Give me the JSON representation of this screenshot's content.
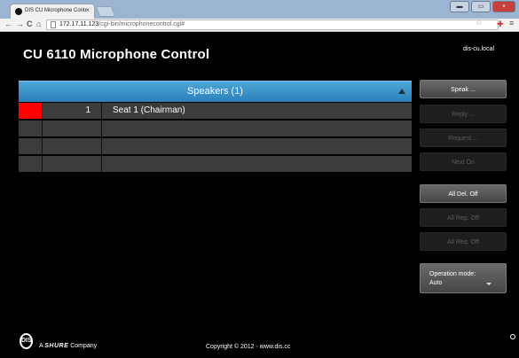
{
  "browser": {
    "tab_title": "DIS CU Microphone Contr",
    "tab_close": "×",
    "url_host": "172.17.11.123",
    "url_path": "/cgi-bin/microphonecontrol.cgi#",
    "back": "←",
    "forward": "→",
    "reload": "C",
    "home": "⌂",
    "star": "☆",
    "menu": "≡",
    "window_buttons": [
      "▬",
      "▭",
      "×"
    ]
  },
  "app": {
    "title": "CU 6110 Microphone Control",
    "hostname": "dis-cu.local"
  },
  "speakers": {
    "header": "Speakers (1)",
    "rows": [
      {
        "active": true,
        "number": "1",
        "name": "Seat 1 (Chairman)"
      },
      {
        "active": false,
        "number": "",
        "name": ""
      },
      {
        "active": false,
        "number": "",
        "name": ""
      },
      {
        "active": false,
        "number": "",
        "name": ""
      }
    ]
  },
  "actions": {
    "speak": "Speak ...",
    "reply": "Reply ...",
    "request": "Request ...",
    "next_on": "Next On",
    "all_del_off": "All Del. Off",
    "all_rep_off": "All Rep. Off",
    "all_req_off": "All Req. Off"
  },
  "operation_mode": {
    "label": "Operation mode:",
    "value": "Auto"
  },
  "footer": {
    "logo_text": "DIS",
    "company_prefix": "A",
    "company_brand": "SHURE",
    "company_suffix": "Company",
    "copyright": "Copyright © 2012 - www.dis.cc"
  },
  "colors": {
    "accent_blue": "#2a7fb8",
    "active_red": "#ff0000",
    "background": "#000000"
  }
}
